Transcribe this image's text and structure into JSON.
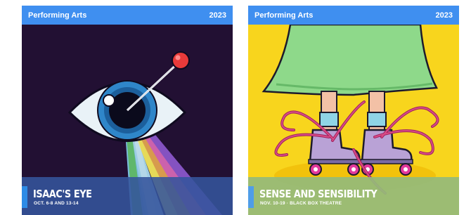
{
  "cards": [
    {
      "category": "Performing Arts",
      "year": "2023",
      "title": "ISAAC'S EYE",
      "subtitle": "OCT. 6-8 AND 13-14",
      "colors": {
        "header": "#3f8ff0",
        "background": "#221033",
        "banner": "#34549c"
      }
    },
    {
      "category": "Performing Arts",
      "year": "2023",
      "title": "SENSE AND SENSIBILITY",
      "subtitle": "NOV. 10-19 · BLACK BOX THEATRE",
      "colors": {
        "header": "#3f8ff0",
        "background": "#f8d51d",
        "banner": "#94ba7a"
      }
    }
  ]
}
